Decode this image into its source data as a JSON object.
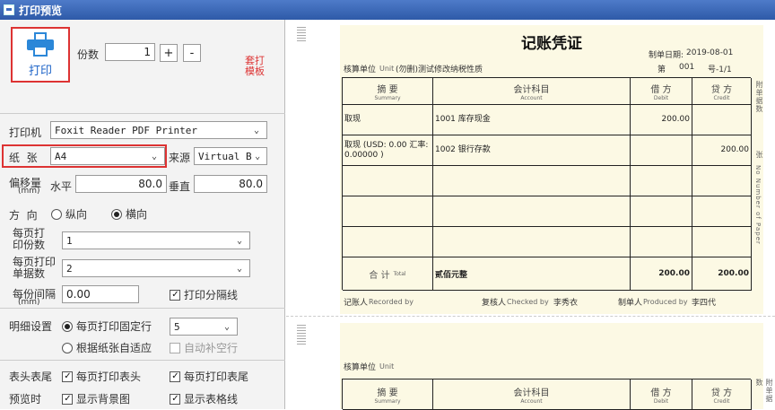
{
  "window": {
    "title": "打印预览"
  },
  "print_button": {
    "label": "打印"
  },
  "copies": {
    "label": "份数",
    "value": "1",
    "plus": "+",
    "minus": "-"
  },
  "template_print": {
    "label": "套打\n模板"
  },
  "printer": {
    "label": "打印机",
    "value": "Foxit Reader PDF Printer"
  },
  "paper": {
    "label": "纸  张",
    "value": "A4",
    "source_label": "来源",
    "source_value": "Virtual Bin"
  },
  "offset": {
    "label": "偏移量",
    "unit": "(mm)",
    "h_label": "水平",
    "h_value": "80.0",
    "v_label": "垂直",
    "v_value": "80.0"
  },
  "orientation": {
    "label": "方  向",
    "portrait": "纵向",
    "landscape": "横向",
    "selected": "横向"
  },
  "per_page_copies": {
    "label": "每页打\n印份数",
    "value": "1"
  },
  "per_page_docs": {
    "label": "每页打印\n单据数",
    "value": "2"
  },
  "copy_gap": {
    "label": "每份间隔",
    "unit": "(mm)",
    "value": "0.00",
    "sep_label": "打印分隔线",
    "sep_checked": true
  },
  "detail": {
    "label": "明细设置",
    "fixed_label": "每页打印固定行",
    "fixed_value": "5",
    "auto_label": "根据纸张自适应",
    "fill_label": "自动补空行"
  },
  "header_footer": {
    "label": "表头表尾",
    "header_label": "每页打印表头",
    "footer_label": "每页打印表尾"
  },
  "preview": {
    "label": "预览时",
    "bg_label": "显示背景图",
    "grid_label": "显示表格线"
  },
  "voucher": {
    "title": "记账凭证",
    "date_label": "制单日期:",
    "date_value": "2019-08-01",
    "unit_label": "核算单位",
    "unit_en": "Unit",
    "unit_value": "(勿删)测试修改纳税性质",
    "no_label": "第",
    "no_value": "001",
    "no_suffix": "号-1/1",
    "headers": [
      {
        "cn": "摘 要",
        "en": "Summary"
      },
      {
        "cn": "会计科目",
        "en": "Account"
      },
      {
        "cn": "借 方",
        "en": "Debit"
      },
      {
        "cn": "贷 方",
        "en": "Credit"
      }
    ],
    "rows": [
      {
        "summary": "取现",
        "account": "1001 库存现金",
        "debit": "200.00",
        "credit": ""
      },
      {
        "summary": "取现 (USD: 0.00  汇率: 0.00000 )",
        "account": "1002 银行存款",
        "debit": "",
        "credit": "200.00"
      },
      {
        "summary": "",
        "account": "",
        "debit": "",
        "credit": ""
      },
      {
        "summary": "",
        "account": "",
        "debit": "",
        "credit": ""
      },
      {
        "summary": "",
        "account": "",
        "debit": "",
        "credit": ""
      }
    ],
    "total_label": "合 计",
    "total_en": "Total",
    "total_words": "贰佰元整",
    "total_debit": "200.00",
    "total_credit": "200.00",
    "bookkeeper_label": "记账人",
    "bookkeeper_en": "Recorded by",
    "checker_label": "复核人",
    "checker_en": "Checked by",
    "checker_value": "李秀衣",
    "maker_label": "制单人",
    "maker_en": "Produced by",
    "maker_value": "李四代",
    "side_attach": "附单据数",
    "side_attach2": "张",
    "side_number": "No Number of Paper"
  },
  "voucher2": {
    "unit_label": "核算单位",
    "unit_en": "Unit",
    "headers": [
      {
        "cn": "摘 要",
        "en": "Summary"
      },
      {
        "cn": "会计科目",
        "en": "Account"
      },
      {
        "cn": "借 方",
        "en": "Debit"
      },
      {
        "cn": "贷 方",
        "en": "Credit"
      }
    ],
    "side_attach": "附单据数"
  }
}
